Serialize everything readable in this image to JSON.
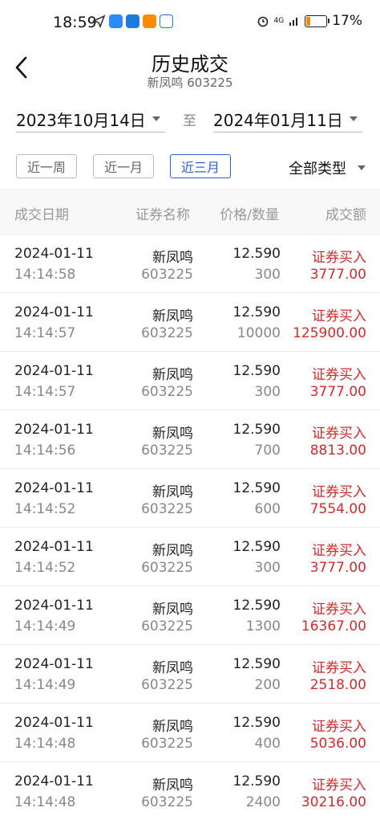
{
  "status": {
    "time": "18:59",
    "battery": "17%",
    "network": "4G",
    "battery_level": 0.17
  },
  "header": {
    "title": "历史成交",
    "subtitle": "新凤鸣 603225"
  },
  "filters": {
    "start_date": "2023年10月14日",
    "separator": "至",
    "end_date": "2024年01月11日",
    "ranges": [
      "近一周",
      "近一月",
      "近三月"
    ],
    "active_range": "近三月",
    "type": "全部类型"
  },
  "columns": [
    "成交日期",
    "证券名称",
    "价格/数量",
    "成交额"
  ],
  "colors": {
    "accent": "#2a62d8",
    "buy": "#d32a2a"
  },
  "trades": [
    {
      "date": "2024-01-11",
      "time": "14:14:58",
      "name": "新凤鸣",
      "code": "603225",
      "price": "12.590",
      "qty": "300",
      "type": "证券买入",
      "amount": "3777.00"
    },
    {
      "date": "2024-01-11",
      "time": "14:14:57",
      "name": "新凤鸣",
      "code": "603225",
      "price": "12.590",
      "qty": "10000",
      "type": "证券买入",
      "amount": "125900.00"
    },
    {
      "date": "2024-01-11",
      "time": "14:14:57",
      "name": "新凤鸣",
      "code": "603225",
      "price": "12.590",
      "qty": "300",
      "type": "证券买入",
      "amount": "3777.00"
    },
    {
      "date": "2024-01-11",
      "time": "14:14:56",
      "name": "新凤鸣",
      "code": "603225",
      "price": "12.590",
      "qty": "700",
      "type": "证券买入",
      "amount": "8813.00"
    },
    {
      "date": "2024-01-11",
      "time": "14:14:52",
      "name": "新凤鸣",
      "code": "603225",
      "price": "12.590",
      "qty": "600",
      "type": "证券买入",
      "amount": "7554.00"
    },
    {
      "date": "2024-01-11",
      "time": "14:14:52",
      "name": "新凤鸣",
      "code": "603225",
      "price": "12.590",
      "qty": "300",
      "type": "证券买入",
      "amount": "3777.00"
    },
    {
      "date": "2024-01-11",
      "time": "14:14:49",
      "name": "新凤鸣",
      "code": "603225",
      "price": "12.590",
      "qty": "1300",
      "type": "证券买入",
      "amount": "16367.00"
    },
    {
      "date": "2024-01-11",
      "time": "14:14:49",
      "name": "新凤鸣",
      "code": "603225",
      "price": "12.590",
      "qty": "200",
      "type": "证券买入",
      "amount": "2518.00"
    },
    {
      "date": "2024-01-11",
      "time": "14:14:48",
      "name": "新凤鸣",
      "code": "603225",
      "price": "12.590",
      "qty": "400",
      "type": "证券买入",
      "amount": "5036.00"
    },
    {
      "date": "2024-01-11",
      "time": "14:14:48",
      "name": "新凤鸣",
      "code": "603225",
      "price": "12.590",
      "qty": "2400",
      "type": "证券买入",
      "amount": "30216.00"
    }
  ]
}
